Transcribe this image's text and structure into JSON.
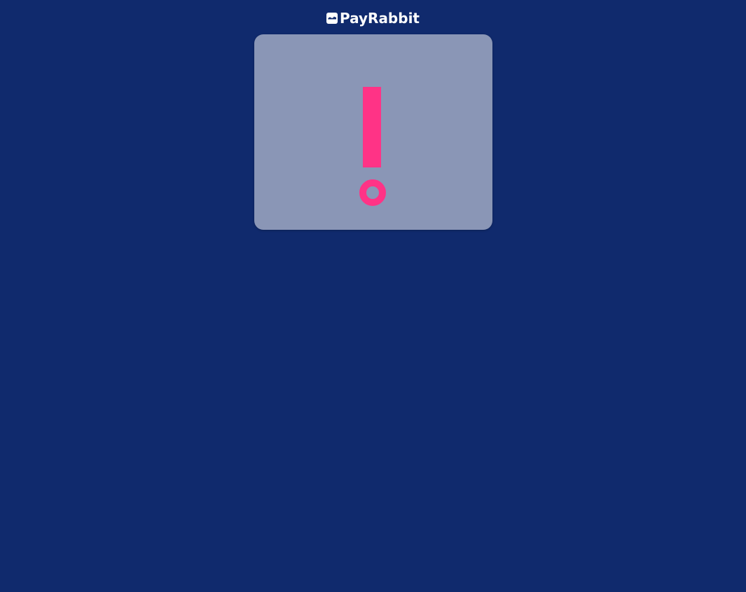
{
  "header": {
    "brand_name": "PayRabbit",
    "logo_icon": "payrabbit-logo-icon"
  },
  "alert_card": {
    "icon": "exclamation-icon",
    "colors": {
      "background": "#102a6d",
      "card": "#8a96b6",
      "accent": "#ff3386",
      "text": "#ffffff"
    }
  }
}
